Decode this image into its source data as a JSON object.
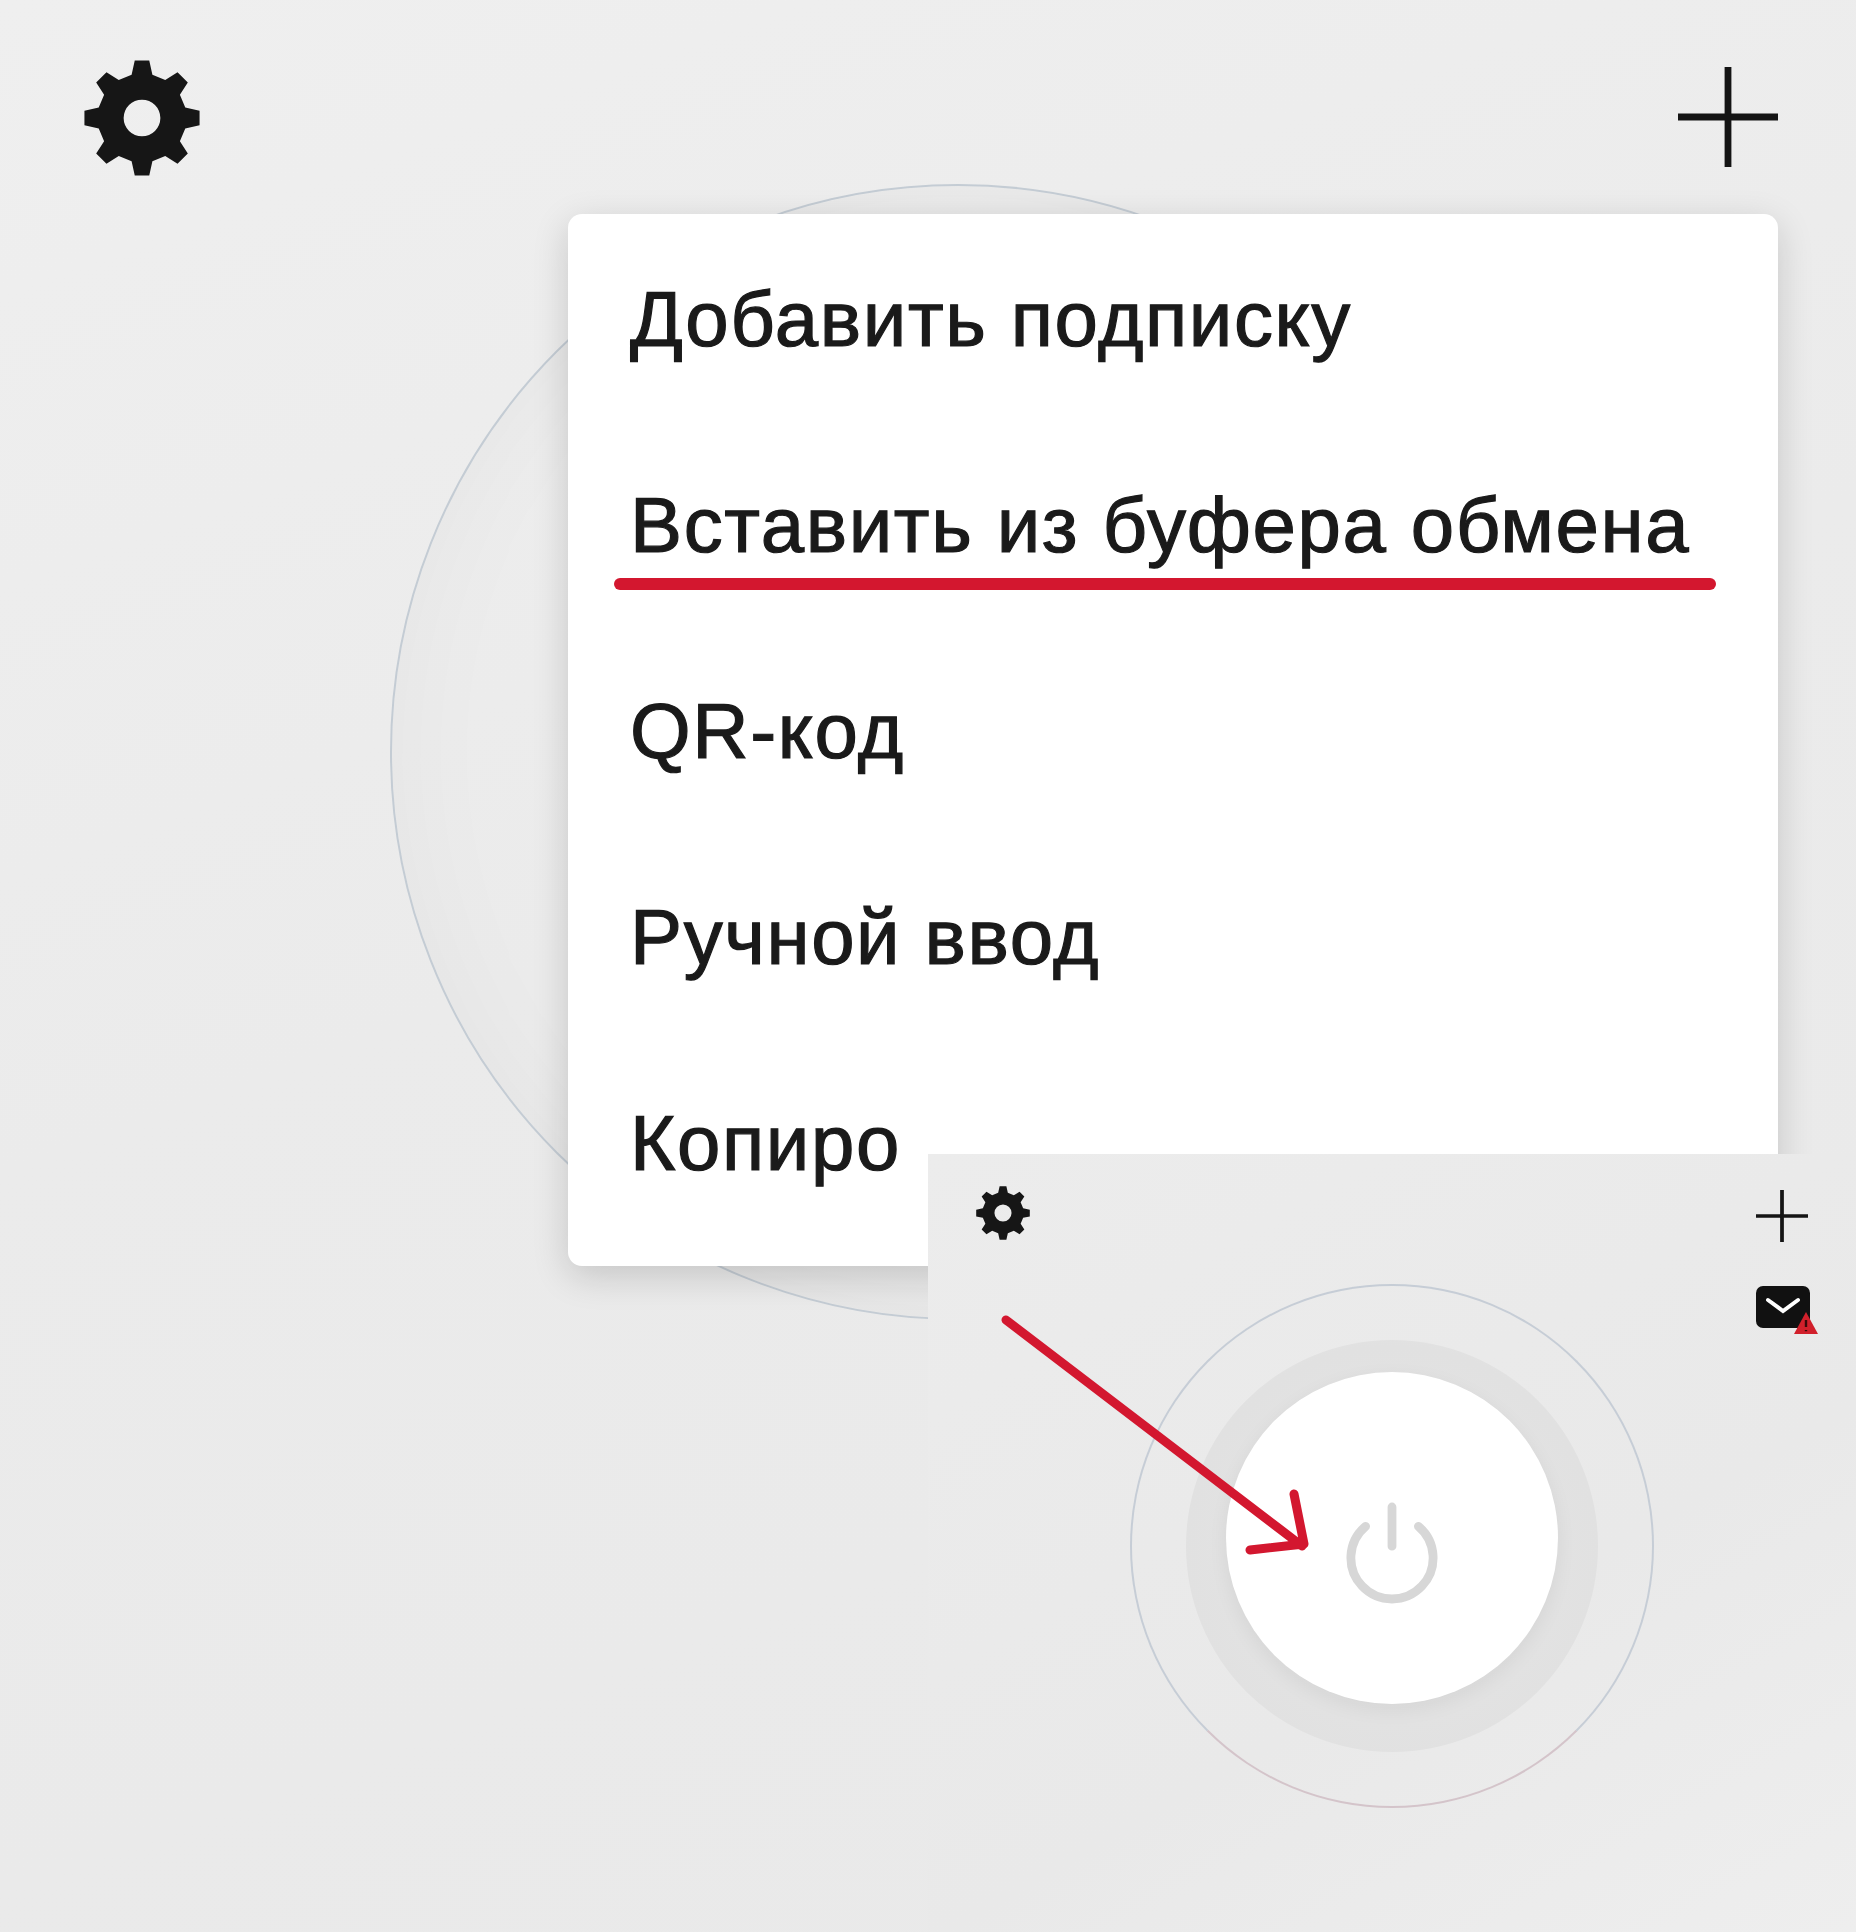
{
  "menu": {
    "items": [
      {
        "label": "Добавить подписку",
        "underlined": false
      },
      {
        "label": "Вставить из буфера обмена",
        "underlined": true
      },
      {
        "label": "QR-код",
        "underlined": false
      },
      {
        "label": "Ручной ввод",
        "underlined": false
      },
      {
        "label": "Копиро",
        "underlined": false
      }
    ]
  },
  "inset": {
    "mail": {
      "alert": true
    },
    "power_button": {
      "on": false
    }
  }
}
